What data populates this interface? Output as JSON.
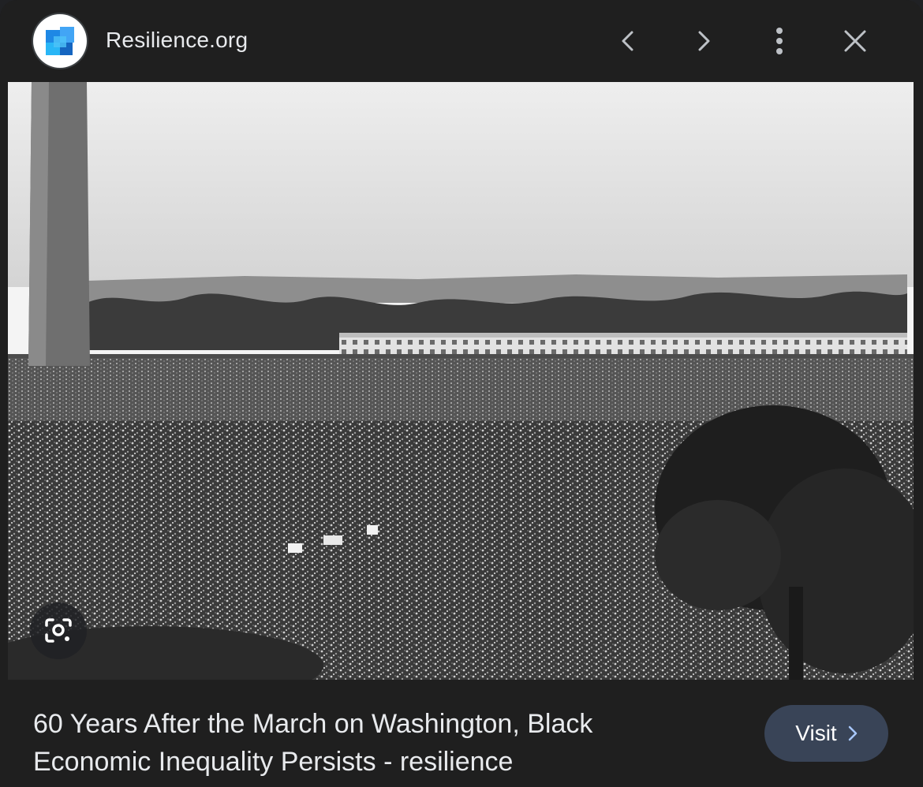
{
  "header": {
    "site_name": "Resilience.org",
    "icons": [
      "favicon",
      "chevron-left-icon",
      "chevron-right-icon",
      "more-vert-icon",
      "close-icon"
    ]
  },
  "image": {
    "alt": "Crowd gathered at the March on Washington with the Washington Monument",
    "lens_icon": "google-lens-icon"
  },
  "caption": {
    "line1": "60 Years After the March on Washington, Black",
    "line2": "Economic Inequality Persists - resilience"
  },
  "visit_button": {
    "label": "Visit",
    "icon": "chevron-right-icon"
  },
  "colors": {
    "background": "#1f1f1f",
    "text": "#e8eaed",
    "visit_bg": "#394457",
    "visit_chevron": "#a8c7fa"
  }
}
